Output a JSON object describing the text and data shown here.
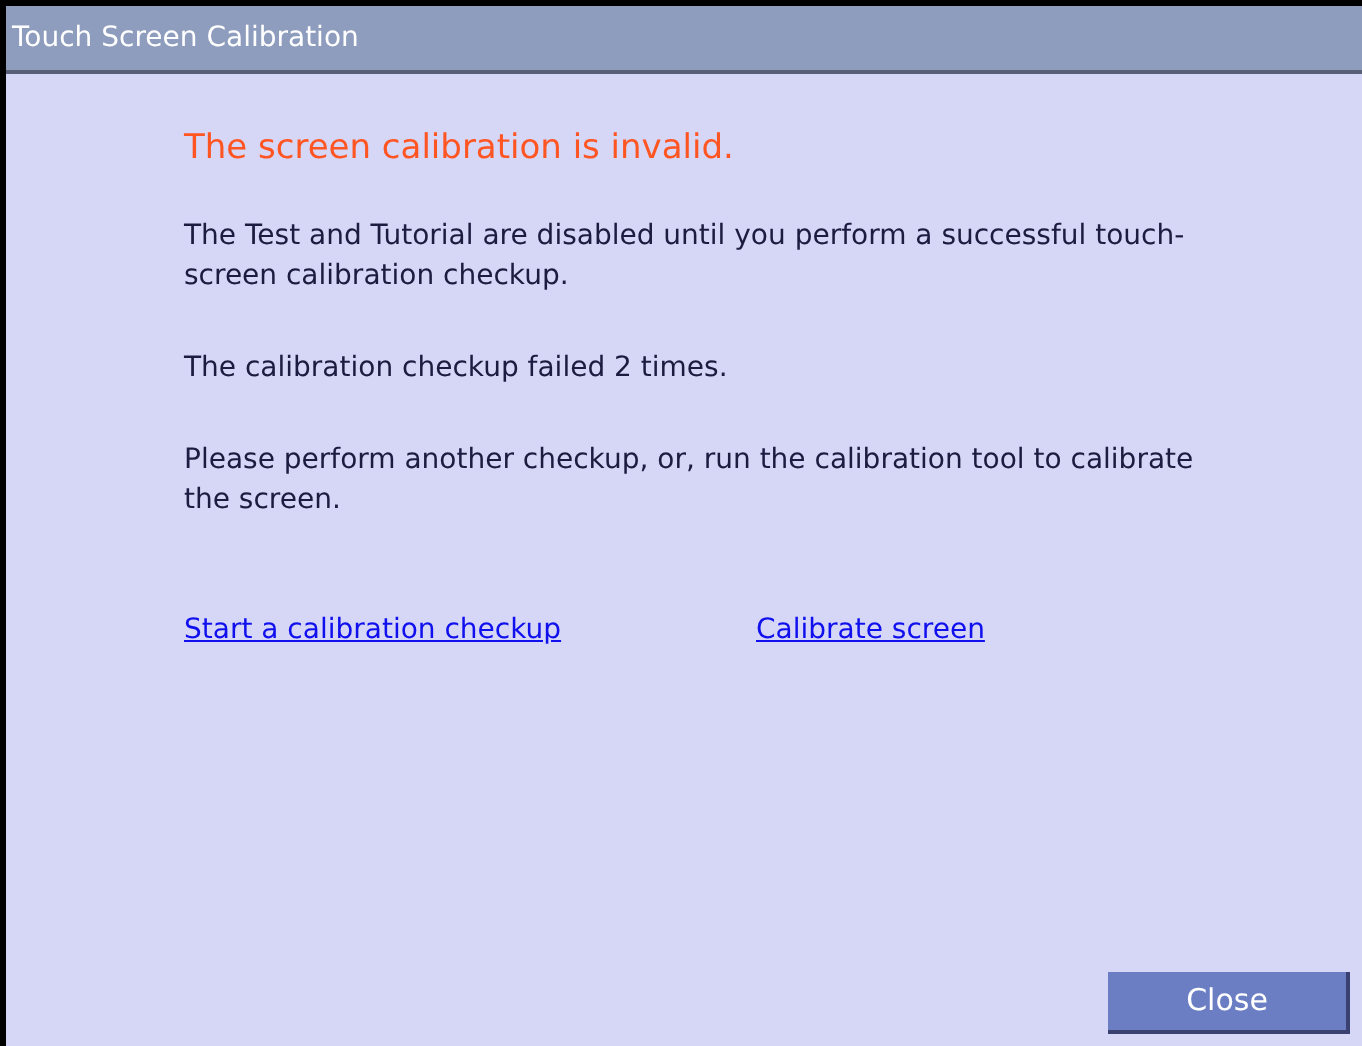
{
  "window": {
    "title": "Touch Screen Calibration"
  },
  "heading": "The screen calibration is invalid.",
  "paragraphs": [
    "The Test and Tutorial are disabled until you perform a successful touch-screen calibration checkup.",
    "The calibration checkup failed 2 times.",
    "Please perform another checkup, or, run the calibration tool to calibrate the screen."
  ],
  "links": [
    "Start a calibration checkup",
    "Calibrate screen"
  ],
  "buttons": [
    "Close"
  ]
}
